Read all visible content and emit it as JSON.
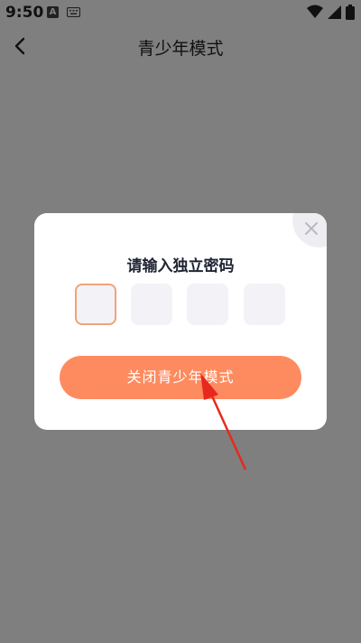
{
  "status_bar": {
    "time": "9:50",
    "notification_letter": "A",
    "icons": [
      "notification-a-icon",
      "keyboard-icon",
      "wifi-icon",
      "signal-icon",
      "battery-icon"
    ]
  },
  "header": {
    "title": "青少年模式",
    "back_icon": "chevron-left-icon"
  },
  "dialog": {
    "title": "请输入独立密码",
    "pin_length": 4,
    "pin_values": [
      "",
      "",
      "",
      ""
    ],
    "active_index": 0,
    "primary_button_label": "关闭青少年模式",
    "close_icon": "close-icon"
  },
  "annotation": {
    "icon": "red-arrow-icon"
  },
  "colors": {
    "primary_button": "#fe8b5f",
    "active_pin_border": "#f0a37c",
    "pin_background": "#f3f3f7",
    "overlay": "#808080",
    "arrow": "#e8281f"
  }
}
